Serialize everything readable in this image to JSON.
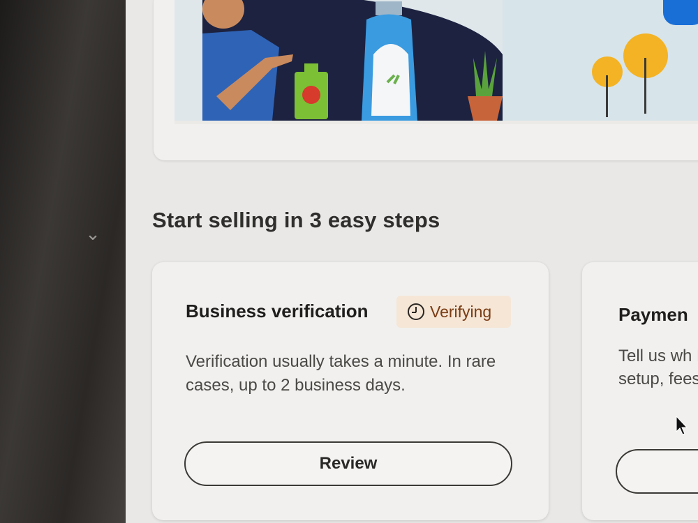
{
  "background": {
    "desk_color": "#2a2725",
    "chevron_icon": "chevron-down-icon"
  },
  "page": {
    "section_title": "Start selling in 3 easy steps"
  },
  "steps": [
    {
      "title": "Business verification",
      "status_badge": {
        "icon": "clock-icon",
        "label": "Verifying",
        "color": "#7a3c14"
      },
      "description": "Verification usually takes a minute. In rare cases, up to 2 business days.",
      "button_label": "Review"
    },
    {
      "title": "Paymen",
      "description": "Tell us wh No setup, fees.",
      "button_label": ""
    }
  ],
  "colors": {
    "page_bg": "#e9e8e6",
    "card_bg": "#f1f0ee",
    "accent_blue": "#1a6fd6",
    "badge_bg": "#f5e6d6"
  }
}
